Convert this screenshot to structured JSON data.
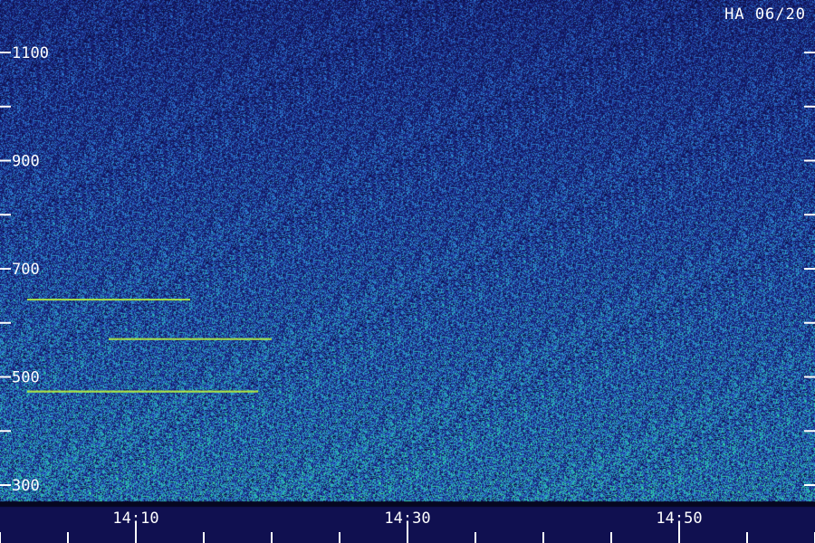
{
  "stamp": "HA 06/20",
  "colors": {
    "background": "#0a0a3a",
    "low": "#1c2a8c",
    "mid": "#2f7fd6",
    "high": "#27d6a0",
    "peak": "#b8f040",
    "label": "#ffffff"
  },
  "chart_data": {
    "type": "heatmap",
    "title": "",
    "xlabel": "",
    "ylabel": "",
    "x_tick_labels": [
      "14:10",
      "14:30",
      "14:50"
    ],
    "x_tick_values": [
      "14:10",
      "14:30",
      "14:50"
    ],
    "y_tick_labels": [
      "300",
      "500",
      "700",
      "900",
      "1100"
    ],
    "y_tick_values": [
      300,
      500,
      700,
      900,
      1100
    ],
    "ylim": [
      260,
      1160
    ],
    "xlim": [
      "14:02",
      "15:00"
    ],
    "intensity_note": "noise floor strongest at low frequency, weaker at high frequency",
    "narrowband_lines": [
      {
        "freq": 643,
        "start": "14:02",
        "end": "14:14"
      },
      {
        "freq": 473,
        "start": "14:02",
        "end": "14:19"
      },
      {
        "freq": 570,
        "start": "14:08",
        "end": "14:20"
      }
    ]
  }
}
